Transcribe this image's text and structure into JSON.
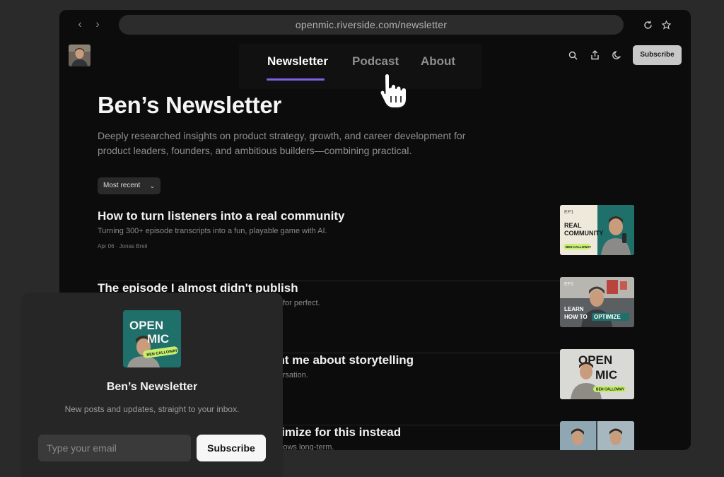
{
  "browser": {
    "url": "openmic.riverside.com/newsletter",
    "back_icon": "chevron-left-icon",
    "forward_icon": "chevron-right-icon",
    "reload_icon": "reload-icon",
    "bookmark_icon": "star-icon"
  },
  "header": {
    "nav": [
      "Newsletter",
      "Podcast",
      "About"
    ],
    "active_tab": "Newsletter",
    "subscribe_label": "Subscribe",
    "icons": [
      "search-icon",
      "share-icon",
      "moon-icon"
    ],
    "accent_color": "#7e61e6"
  },
  "main": {
    "title": "Ben’s Newsletter",
    "description": "Deeply researched insights on product strategy, growth, and career development for product leaders, founders, and ambitious builders—combining practical.",
    "sort_label": "Most recent",
    "posts": [
      {
        "title": "How to turn listeners into a real community",
        "subtitle": "Turning 300+ episode transcripts into a fun, playable game with AI.",
        "meta": "Apr 06 · Jonas Breil",
        "thumb": {
          "ep": "EP1",
          "line1": "REAL",
          "line2": "COMMUNITY",
          "badge": "BEN CALLOWAY"
        }
      },
      {
        "title": "The episode I almost didn't publish",
        "subtitle": "for perfect.",
        "thumb": {
          "ep": "EP2",
          "line1": "LEARN",
          "line2": "HOW TO",
          "highlight": "OPTIMIZE"
        }
      },
      {
        "title": "ght me about storytelling",
        "subtitle": "nversation.",
        "thumb": {
          "line1": "OPEN",
          "line2": "MIC",
          "badge": "BEN CALLOWAY"
        }
      },
      {
        "title": "otimize for this instead",
        "subtitle": "y grows long-term."
      }
    ]
  },
  "popup": {
    "logo_line1": "OPEN",
    "logo_line2": "MIC",
    "logo_badge": "BEN CALLOWAY",
    "title": "Ben’s Newsletter",
    "subtitle": "New posts and updates, straight to your inbox.",
    "email_placeholder": "Type your email",
    "subscribe_label": "Subscribe"
  }
}
